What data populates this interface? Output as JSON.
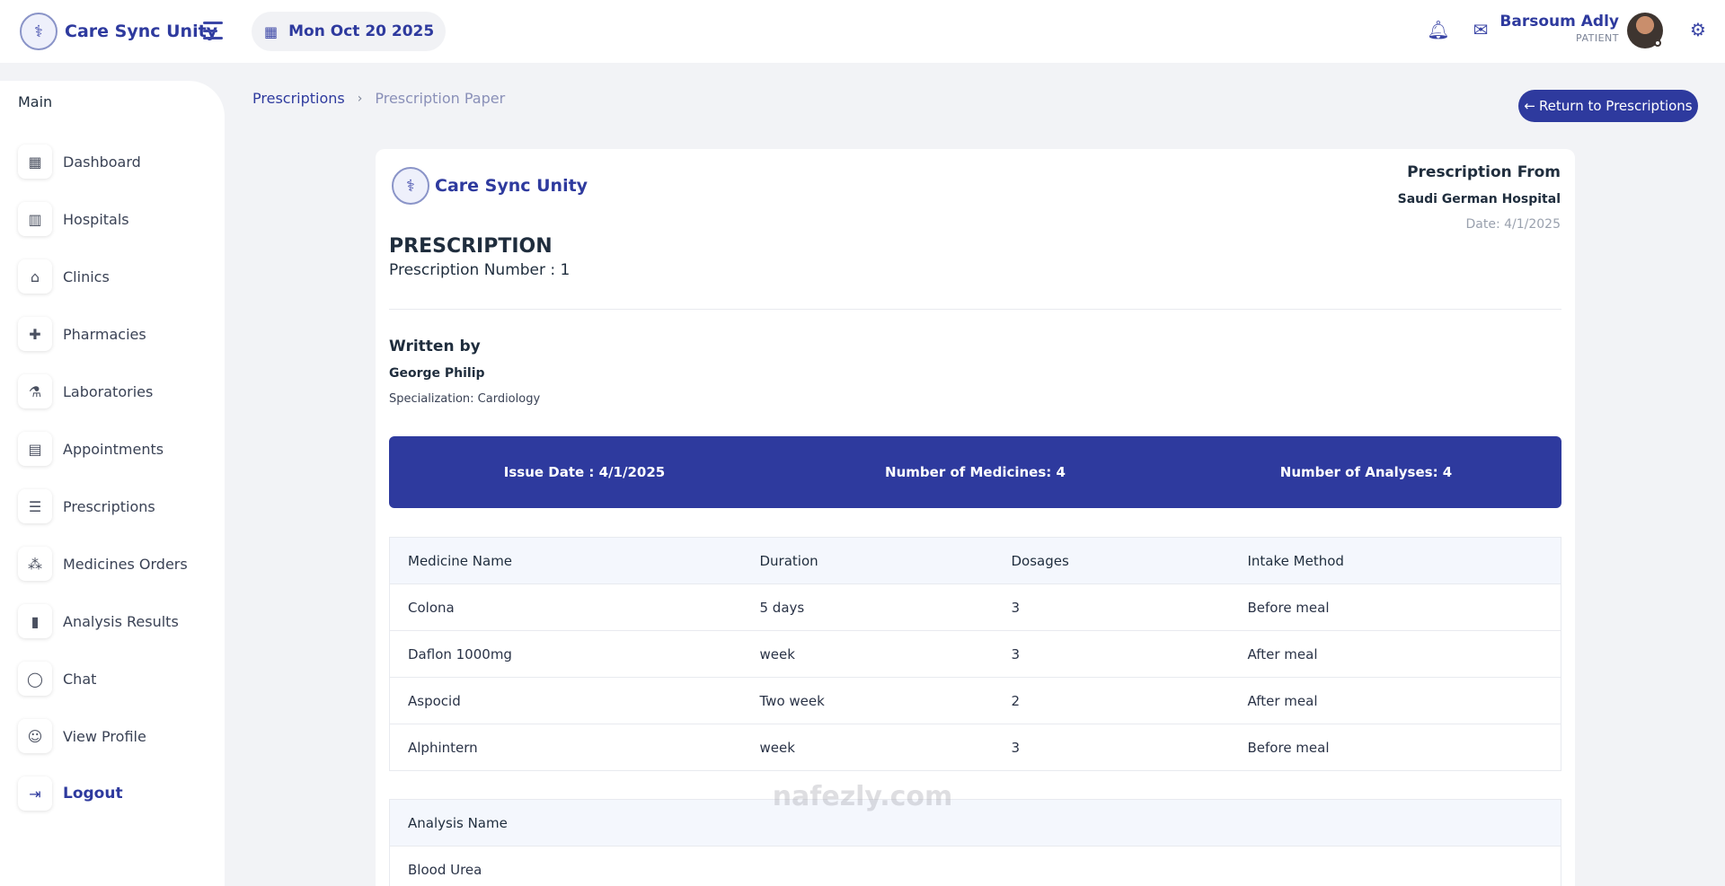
{
  "app": {
    "brand_name": "Care Sync Unity",
    "current_date": "Mon Oct 20 2025"
  },
  "header": {
    "user_name": "Barsoum Adly",
    "user_role": "PATIENT",
    "icons": [
      "bell-icon",
      "messages-icon",
      "settings-gear-icon"
    ]
  },
  "sidebar": {
    "heading": "Main",
    "items": [
      {
        "label": "Dashboard",
        "icon": "dashboard-icon"
      },
      {
        "label": "Hospitals",
        "icon": "hospital-icon"
      },
      {
        "label": "Clinics",
        "icon": "clinic-icon"
      },
      {
        "label": "Pharmacies",
        "icon": "pharmacy-icon"
      },
      {
        "label": "Laboratories",
        "icon": "laboratory-icon"
      },
      {
        "label": "Appointments",
        "icon": "appointment-icon"
      },
      {
        "label": "Prescriptions",
        "icon": "prescription-icon"
      },
      {
        "label": "Medicines Orders",
        "icon": "medicine-order-icon"
      },
      {
        "label": "Analysis Results",
        "icon": "chart-icon"
      },
      {
        "label": "Chat",
        "icon": "chat-icon"
      },
      {
        "label": "View Profile",
        "icon": "profile-icon"
      },
      {
        "label": "Logout",
        "icon": "logout-icon"
      }
    ]
  },
  "breadcrumb": {
    "parent": "Prescriptions",
    "current": "Prescription Paper"
  },
  "return_button": "Return to Prescriptions",
  "prescription": {
    "brand_name": "Care Sync Unity",
    "from_title": "Prescription From",
    "hospital": "Saudi German Hospital",
    "date": "Date: 4/1/2025",
    "title": "PRESCRIPTION",
    "number": "Prescription Number : 1",
    "written_by_title": "Written by",
    "doctor_name": "George Philip",
    "doctor_specialization": "Specialization: Cardiology",
    "summary": {
      "issue_date": "Issue Date : 4/1/2025",
      "medicines_count": "Number of Medicines: 4",
      "analyses_count": "Number of Analyses: 4"
    },
    "medicines": {
      "headers": [
        "Medicine Name",
        "Duration",
        "Dosages",
        "Intake Method"
      ],
      "rows": [
        [
          "Colona",
          "5 days",
          "3",
          "Before meal"
        ],
        [
          "Daflon 1000mg",
          "week",
          "3",
          "After meal"
        ],
        [
          "Aspocid",
          "Two week",
          "2",
          "After meal"
        ],
        [
          "Alphintern",
          "week",
          "3",
          "Before meal"
        ]
      ]
    },
    "analyses": {
      "headers": [
        "Analysis Name"
      ],
      "rows": [
        [
          "Blood Urea"
        ]
      ]
    }
  },
  "watermark": "nafezly.com",
  "colors": {
    "primary": "#2e3a9e",
    "background": "#f2f3f6",
    "table_header": "#f4f7fd"
  }
}
